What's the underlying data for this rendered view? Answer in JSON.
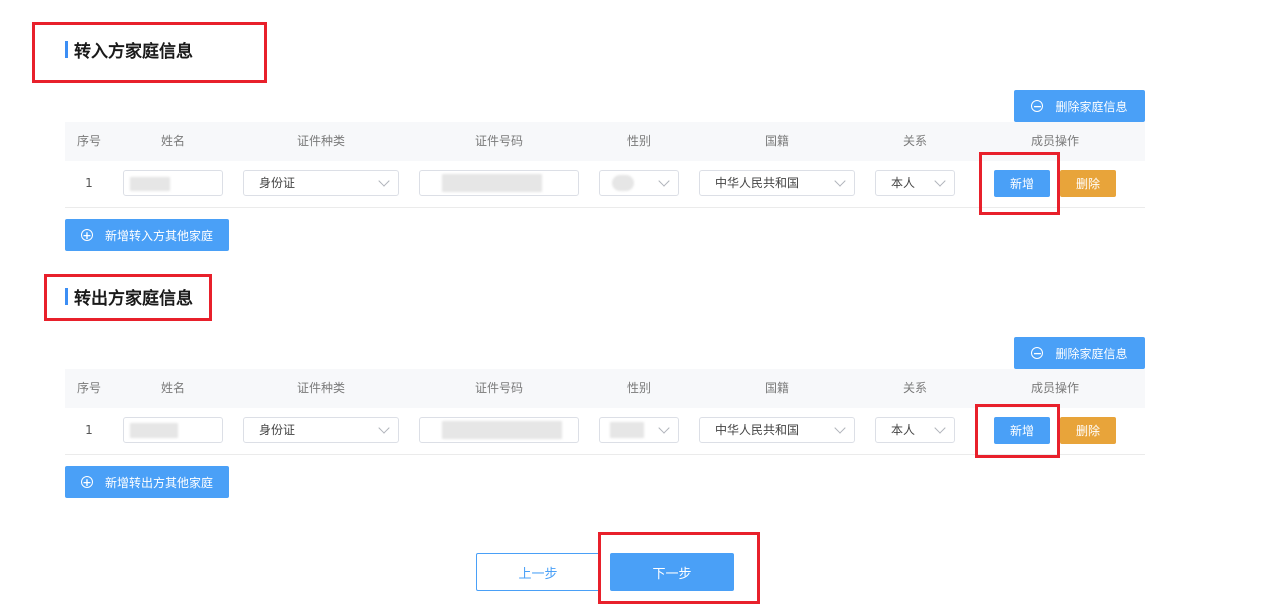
{
  "section_in": {
    "title": "转入方家庭信息",
    "delete_family_label": "删除家庭信息",
    "add_family_label": "新增转入方其他家庭"
  },
  "section_out": {
    "title": "转出方家庭信息",
    "delete_family_label": "删除家庭信息",
    "add_family_label": "新增转出方其他家庭"
  },
  "table": {
    "columns": [
      "序号",
      "姓名",
      "证件种类",
      "证件号码",
      "性别",
      "国籍",
      "关系",
      "成员操作"
    ]
  },
  "rows_in": [
    {
      "index": "1",
      "name": "",
      "id_type": "身份证",
      "id_number": "",
      "gender": "",
      "nationality": "中华人民共和国",
      "relation": "本人",
      "add_label": "新增",
      "delete_label": "删除"
    }
  ],
  "rows_out": [
    {
      "index": "1",
      "name": "",
      "id_type": "身份证",
      "id_number": "",
      "gender": "",
      "nationality": "中华人民共和国",
      "relation": "本人",
      "add_label": "新增",
      "delete_label": "删除"
    }
  ],
  "footer": {
    "prev_label": "上一步",
    "next_label": "下一步"
  },
  "colors": {
    "primary": "#4aa0f7",
    "warning": "#e8a43a",
    "highlight_box": "#e8202b",
    "title_bar": "#3c8ef4"
  },
  "icons": {
    "delete_family": "minus-circle-icon",
    "add_family": "plus-circle-icon",
    "select": "chevron-down-icon"
  }
}
